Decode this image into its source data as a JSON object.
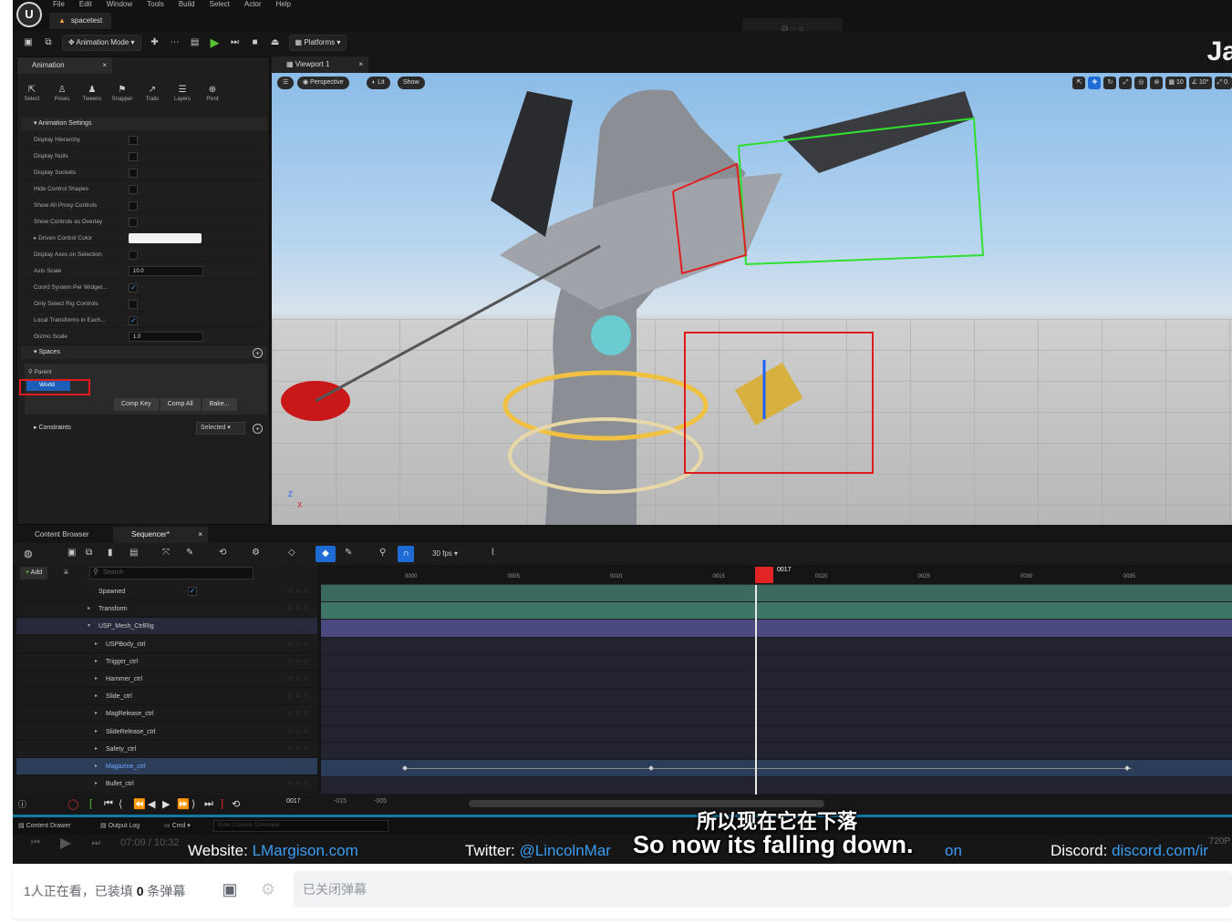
{
  "menubar": {
    "logo": "U",
    "items": [
      "File",
      "Edit",
      "Window",
      "Tools",
      "Build",
      "Select",
      "Actor",
      "Help"
    ],
    "project_tab": "spacetest"
  },
  "toolbar": {
    "mode_label": "Animation Mode",
    "platforms_label": "Platforms",
    "overlay_text": "Ja"
  },
  "anim_panel": {
    "tab": "Animation",
    "tools": [
      "Select",
      "Poses",
      "Tweens",
      "Snapper",
      "Trails",
      "Layers",
      "Pivot"
    ],
    "settings_header": "Animation Settings",
    "props": [
      {
        "label": "Display Hierarchy",
        "type": "checkbox",
        "checked": false
      },
      {
        "label": "Display Nulls",
        "type": "checkbox",
        "checked": false
      },
      {
        "label": "Display Sockets",
        "type": "checkbox",
        "checked": false
      },
      {
        "label": "Hide Control Shapes",
        "type": "checkbox",
        "checked": false
      },
      {
        "label": "Show All Proxy Controls",
        "type": "checkbox",
        "checked": false
      },
      {
        "label": "Show Controls as Overlay",
        "type": "checkbox",
        "checked": false
      },
      {
        "label": "Driven Control Color",
        "type": "color",
        "value": "#f1f1f1"
      },
      {
        "label": "Display Axes on Selection",
        "type": "checkbox",
        "checked": false
      },
      {
        "label": "Axis Scale",
        "type": "number",
        "value": "10.0"
      },
      {
        "label": "Coord System Per Widget...",
        "type": "checkbox",
        "checked": true
      },
      {
        "label": "Only Select Rig Controls",
        "type": "checkbox",
        "checked": false
      },
      {
        "label": "Local Transforms in Each...",
        "type": "checkbox",
        "checked": true
      },
      {
        "label": "Gizmo Scale",
        "type": "number",
        "value": "1.0"
      }
    ],
    "spaces_header": "Spaces",
    "space_parent": "Parent",
    "space_world": "World",
    "comp_buttons": [
      "Comp Key",
      "Comp All",
      "Bake..."
    ],
    "constraints_header": "Constraints",
    "constraints_filter": "Selected"
  },
  "viewport": {
    "tab": "Viewport 1",
    "perspective": "Perspective",
    "lit": "Lit",
    "show": "Show",
    "grid_snap": "10",
    "rot_snap": "10°",
    "scale_snap": "0.",
    "axis_labels": [
      "Z",
      "X"
    ]
  },
  "sequencer": {
    "tabs": [
      "Content Browser",
      "Sequencer*"
    ],
    "fps": "30 fps",
    "add_label": "Add",
    "search_placeholder": "Search",
    "tracks": [
      {
        "label": "Spawned",
        "indent": 0,
        "expandable": false,
        "has_check": true
      },
      {
        "label": "Transform",
        "indent": 0,
        "expandable": true
      },
      {
        "label": "USP_Mesh_CtrlRig",
        "indent": 0,
        "expandable": true,
        "expanded": true,
        "rig": true
      },
      {
        "label": "USPBody_ctrl",
        "indent": 1,
        "expandable": true
      },
      {
        "label": "Trigger_ctrl",
        "indent": 1,
        "expandable": true
      },
      {
        "label": "Hammer_ctrl",
        "indent": 1,
        "expandable": true
      },
      {
        "label": "Slide_ctrl",
        "indent": 1,
        "expandable": true
      },
      {
        "label": "MagRelease_ctrl",
        "indent": 1,
        "expandable": true
      },
      {
        "label": "SlideRelease_ctrl",
        "indent": 1,
        "expandable": true
      },
      {
        "label": "Safety_ctrl",
        "indent": 1,
        "expandable": true
      },
      {
        "label": "Magazine_ctrl",
        "indent": 1,
        "expandable": true,
        "selected": true
      },
      {
        "label": "Bullet_ctrl",
        "indent": 1,
        "expandable": true
      }
    ],
    "ruler_ticks": [
      "0000",
      "0005",
      "0010",
      "0015",
      "0020",
      "0025",
      "0030",
      "0035"
    ],
    "current_frame": "0017",
    "transport_frame": "0017",
    "range_start": "-015",
    "range_end": "-005",
    "status": {
      "content_drawer": "Content Drawer",
      "output_log": "Output Log",
      "cmd": "Cmd",
      "console_placeholder": "Enter Console Command"
    }
  },
  "player": {
    "time": "07:09 / 10:32",
    "quality": "720P"
  },
  "links": {
    "website_label": "Website:",
    "website_value": "LMargison.com",
    "twitter_label": "Twitter:",
    "twitter_value": "@LincolnMar",
    "twitter_tail": "on",
    "discord_label": "Discord:",
    "discord_value": "discord.com/ir"
  },
  "subtitles": {
    "zh": "所以现在它在下落",
    "en": "So now its falling down."
  },
  "danmaku": {
    "viewers_prefix": "1人正在看，已装填",
    "count": "0",
    "viewers_suffix": "条弹幕",
    "input_placeholder": "已关闭弹幕"
  },
  "colors": {
    "selection_blue": "#1e6bd6",
    "highlight_red": "#e01b1b",
    "link_blue": "#3b9cf0",
    "play_green": "#56c431"
  }
}
